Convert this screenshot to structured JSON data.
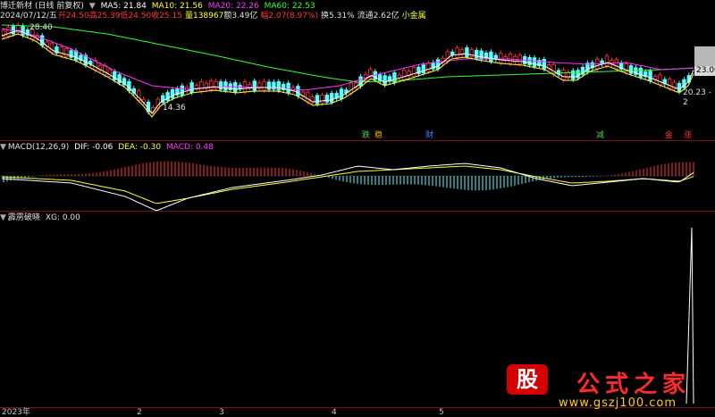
{
  "main_header": {
    "stock_name": "博迁新材",
    "mode": "(日线 前复权)",
    "ma5": "MA5: 21.84",
    "ma10": "MA10: 21.56",
    "ma20": "MA20: 22.26",
    "ma60": "MA60: 22.53"
  },
  "info_line": {
    "date": "2024/07/12/五",
    "open": "开24.50",
    "high": "高25.39",
    "low": "低24.50",
    "close": "收25.15",
    "volume": "量138967",
    "amount": "额3.49亿",
    "change": "幅2.07(8.97%)",
    "turnover": "换5.31%",
    "float_cap": "流通2.62亿",
    "sector": "小金属"
  },
  "price_labels": {
    "high_mark": "28.40",
    "low_mark": "14.36",
    "right_mid": "23.06",
    "right_low": "20.23 - 2"
  },
  "signals": [
    {
      "text": "跌",
      "color": "#50d050"
    },
    {
      "text": "稳",
      "color": "#ffb000"
    },
    {
      "text": "财",
      "color": "#3a8cff"
    },
    {
      "text": "减",
      "color": "#50d050"
    },
    {
      "text": "金",
      "color": "#ff3030"
    },
    {
      "text": "涨",
      "color": "#ff3030"
    }
  ],
  "macd_header": {
    "name": "MACD(12,26,9)",
    "dif": "DIF: -0.06",
    "dea": "DEA: -0.30",
    "macd": "MACD: 0.48"
  },
  "xg_header": {
    "name": "霹雳破晓",
    "xg": "XG: 0.00"
  },
  "x_axis": {
    "labels": [
      "2023年",
      "2",
      "3",
      "4",
      "5"
    ]
  },
  "logo": {
    "glyph": "股",
    "brand": "公式之家",
    "url": "www.gszj100.com"
  },
  "colors": {
    "up": "#ff3333",
    "down": "#54ffff",
    "ma5": "#ffffff",
    "ma10": "#ffff33",
    "ma20": "#ff33ff",
    "ma60": "#33ff33",
    "grid": "#7a1010"
  }
}
